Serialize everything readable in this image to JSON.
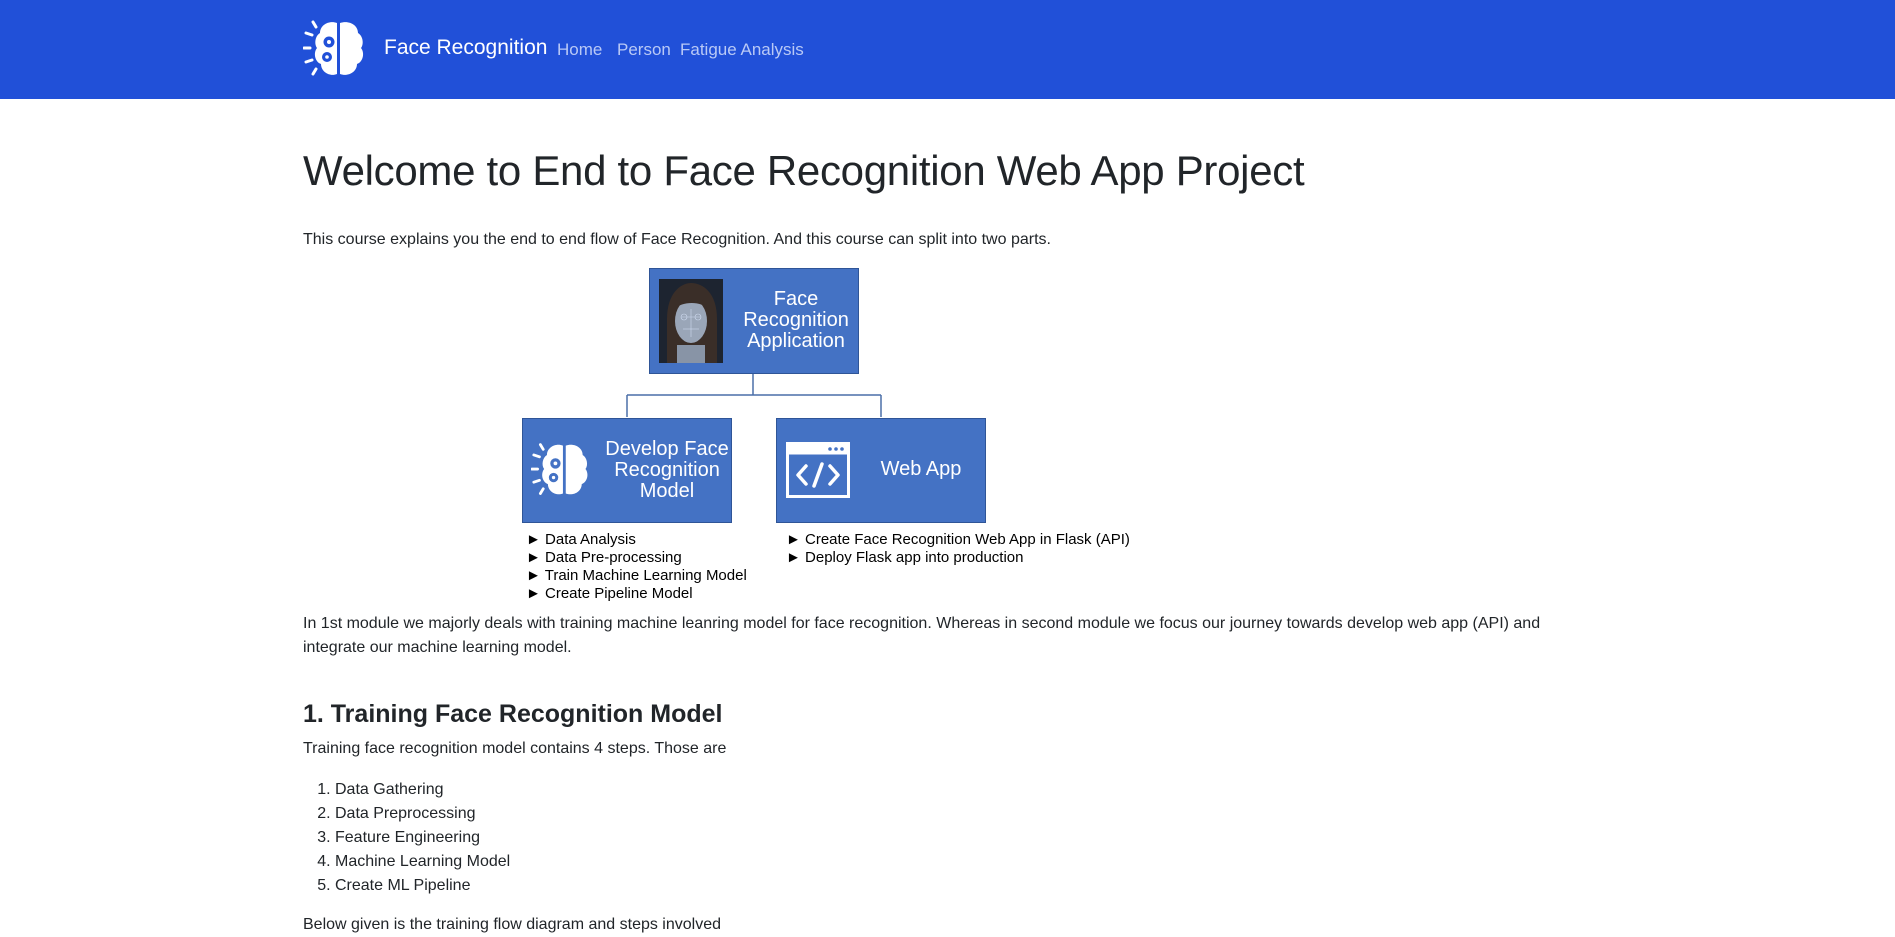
{
  "navbar": {
    "brand": "Face Recognition",
    "links": [
      "Home",
      "Person",
      "Fatigue Analysis"
    ],
    "colors": {
      "background": "#2150d8",
      "link": "#b9c9f6"
    }
  },
  "main": {
    "title": "Welcome to End to Face Recognition Web App Project",
    "intro": "This course explains you the end to end flow of Face Recognition. And this course can split into two parts.",
    "diagram": {
      "root_label_lines": [
        "Face",
        "Recognition",
        "Application"
      ],
      "left_label_lines": [
        "Develop Face",
        "Recognition",
        "Model"
      ],
      "right_label": "Web App",
      "left_items": [
        "► Data Analysis",
        "► Data Pre-processing",
        "► Train Machine Learning Model",
        "►  Create Pipeline Model"
      ],
      "right_items": [
        "► Create Face Recognition Web App in Flask (API)",
        "► Deploy Flask app into production"
      ],
      "colors": {
        "box": "#4472c4",
        "connector": "#4a6fa8"
      }
    },
    "module_summary": "In 1st module we majorly deals with training machine leanring model for face recognition. Whereas in second module we focus our journey towards develop web app (API) and integrate our machine learning model.",
    "section1": {
      "heading": "1. Training Face Recognition Model",
      "lead": "Training face recognition model contains 4 steps. Those are",
      "steps": [
        "Data Gathering",
        "Data Preprocessing",
        "Feature Engineering",
        "Machine Learning Model",
        "Create ML Pipeline"
      ],
      "footer": "Below given is the training flow diagram and steps involved"
    }
  }
}
